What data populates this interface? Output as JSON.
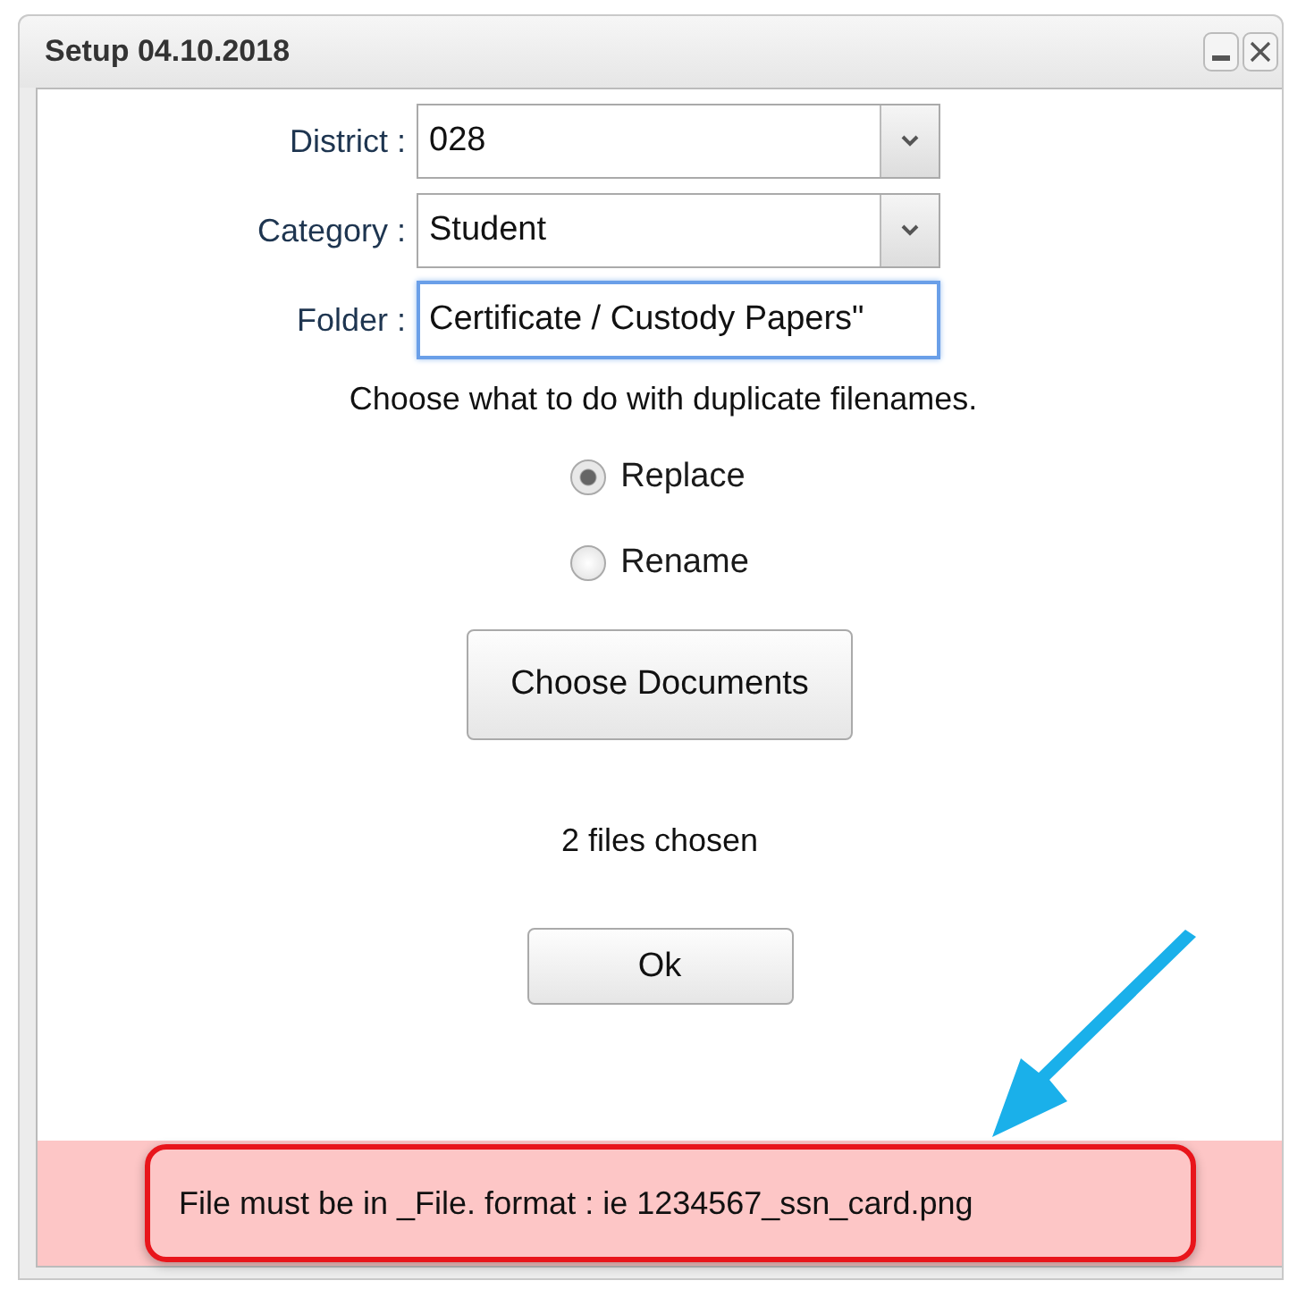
{
  "window": {
    "title": "Setup 04.10.2018"
  },
  "fields": [
    {
      "label": "District :",
      "value": "028",
      "kind": "select",
      "focused": false
    },
    {
      "label": "Category :",
      "value": "Student",
      "kind": "select",
      "focused": false
    },
    {
      "label": "Folder :",
      "value": "Certificate / Custody Papers\"",
      "kind": "text",
      "focused": true
    }
  ],
  "prompt": "Choose what to do with duplicate filenames.",
  "options": [
    {
      "label": "Replace",
      "selected": true
    },
    {
      "label": "Rename",
      "selected": false
    }
  ],
  "choose_button": "Choose Documents",
  "status": "2 files chosen",
  "ok_button": "Ok",
  "message": "File must be in _File. format : ie 1234567_ssn_card.png"
}
